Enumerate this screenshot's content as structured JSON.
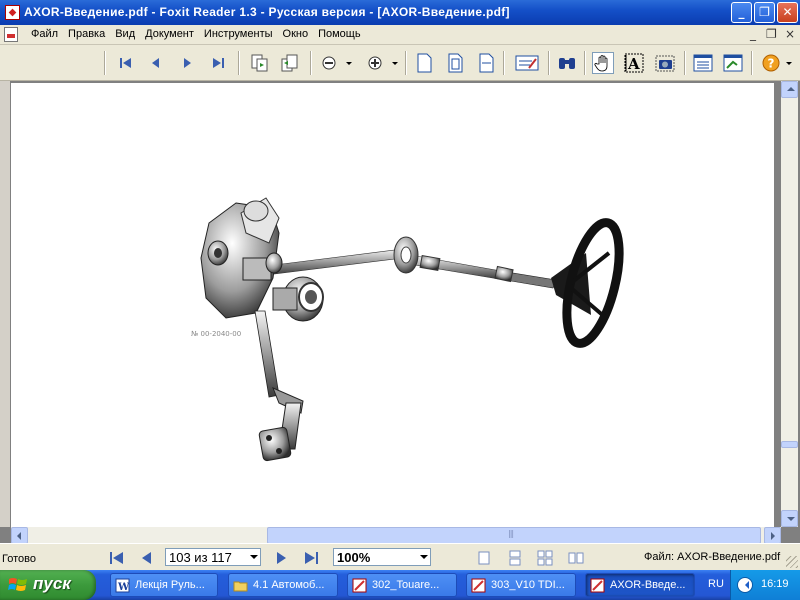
{
  "window": {
    "title": "AXOR-Введение.pdf - Foxit Reader 1.3 - Русская версия  - [AXOR-Введение.pdf]",
    "minimize": "_",
    "maximize": "❐",
    "close": "✕"
  },
  "menu": {
    "items": [
      "Файл",
      "Правка",
      "Вид",
      "Документ",
      "Инструменты",
      "Окно",
      "Помощь"
    ],
    "mdi_min": "_",
    "mdi_restore": "❐",
    "mdi_close": "×"
  },
  "document": {
    "image_label": "№ 00-2040-00"
  },
  "status": {
    "ready": "Готово",
    "page_indicator": "103 из 117",
    "zoom": "100%",
    "file": "Файл: AXOR-Введение.pdf"
  },
  "taskbar": {
    "start_label": "пуск",
    "tasks": [
      "Лекція Руль...",
      "4.1 Автомоб...",
      "302_Touare...",
      "303_V10 TDI...",
      "AXOR-Введе..."
    ],
    "language": "RU",
    "clock": "16:19"
  },
  "colors": {
    "titlebar": "#0a3cb0",
    "taskbar": "#245edb",
    "start": "#3c9a3c"
  }
}
